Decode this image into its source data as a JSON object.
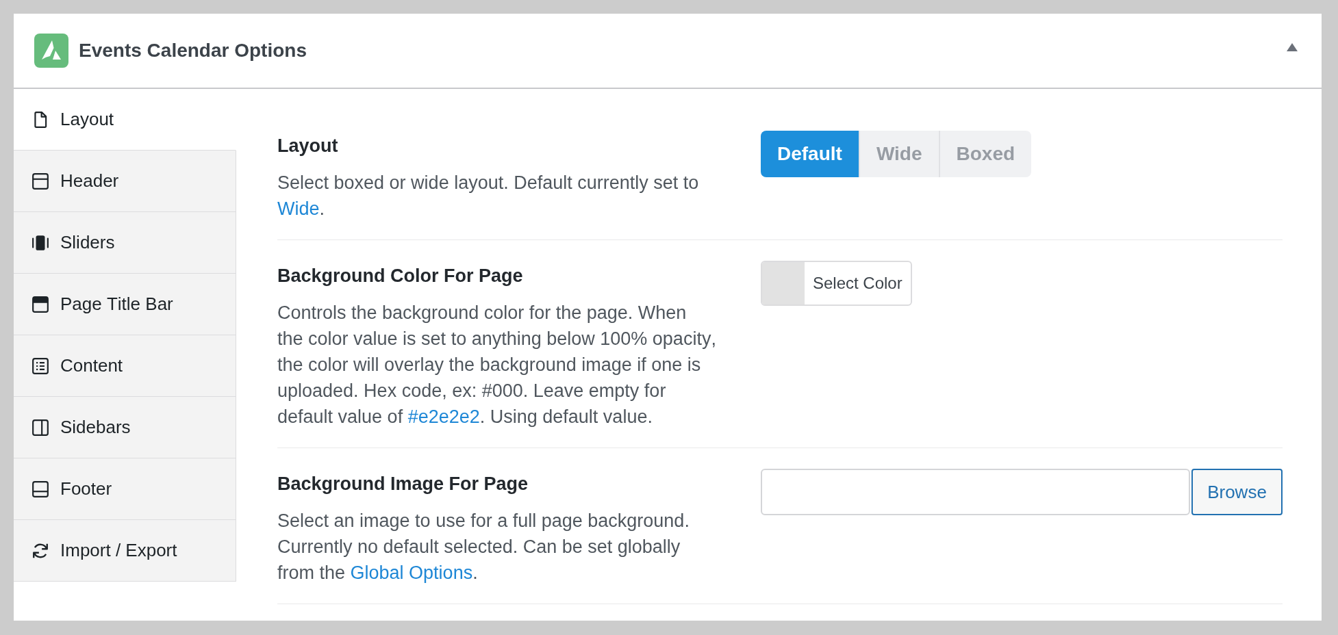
{
  "panel": {
    "title": "Events Calendar Options",
    "expanded": true
  },
  "sidebar": {
    "items": [
      {
        "label": "Layout",
        "selected": true
      },
      {
        "label": "Header",
        "selected": false
      },
      {
        "label": "Sliders",
        "selected": false
      },
      {
        "label": "Page Title Bar",
        "selected": false
      },
      {
        "label": "Content",
        "selected": false
      },
      {
        "label": "Sidebars",
        "selected": false
      },
      {
        "label": "Footer",
        "selected": false
      },
      {
        "label": "Import / Export",
        "selected": false
      }
    ]
  },
  "sections": [
    {
      "title": "Layout",
      "description": [
        {
          "kind": "text",
          "text": "Select boxed or wide layout. Default currently set to "
        },
        {
          "kind": "link",
          "text": "Wide"
        },
        {
          "kind": "text",
          "text": "."
        }
      ],
      "control": {
        "kind": "button_group",
        "options": [
          {
            "label": "Default",
            "selected": true
          },
          {
            "label": "Wide",
            "selected": false
          },
          {
            "label": "Boxed",
            "selected": false
          }
        ]
      }
    },
    {
      "title": "Background Color For Page",
      "description": [
        {
          "kind": "text",
          "text": "Controls the background color for the page. When the color value is set to anything below 100% opacity, the color will overlay the background image if one is uploaded. Hex code, ex: #000. Leave empty for default value of "
        },
        {
          "kind": "link",
          "text": "#e2e2e2"
        },
        {
          "kind": "text",
          "text": ". Using default value."
        }
      ],
      "control": {
        "kind": "color_picker",
        "label": "Select Color",
        "color": "#e2e2e2"
      }
    },
    {
      "title": "Background Image For Page",
      "description": [
        {
          "kind": "text",
          "text": "Select an image to use for a full page background. Currently no default selected. Can be set globally from the "
        },
        {
          "kind": "link",
          "text": "Global Options"
        },
        {
          "kind": "text",
          "text": "."
        }
      ],
      "control": {
        "kind": "media_upload",
        "button_label": "Browse"
      }
    }
  ]
}
